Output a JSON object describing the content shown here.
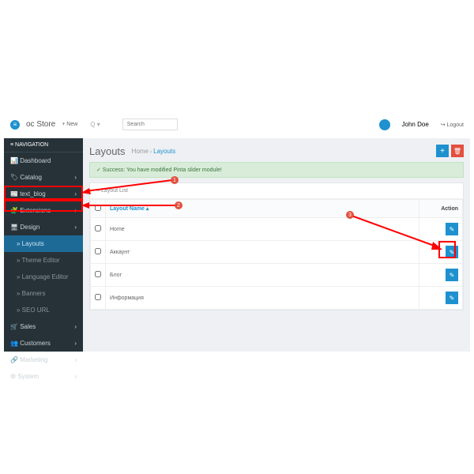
{
  "brand": {
    "name": "oc Store"
  },
  "top": {
    "new": "+ New",
    "search_ph": "Search",
    "user": "John Doe",
    "logout": "↪ Logout"
  },
  "nav": {
    "header": "≡ NAVIGATION",
    "dashboard": "Dashboard",
    "catalog": "Catalog",
    "textblog": "text_blog",
    "extensions": "Extensions",
    "design": "Design",
    "layouts": "Layouts",
    "theme": "Theme Editor",
    "lang": "Language Editor",
    "banners": "Banners",
    "seo": "SEO URL",
    "sales": "Sales",
    "customers": "Customers",
    "marketing": "Marketing",
    "system": "System"
  },
  "page": {
    "title": "Layouts",
    "bc_home": "Home",
    "bc_lay": "Layouts"
  },
  "alert": "✓ Success: You have modified Pinta slider module!",
  "panel": {
    "header": "≡ Layout List"
  },
  "table": {
    "col_name": "Layout Name ▴",
    "col_action": "Action",
    "rows": [
      "Home",
      "Аккаунт",
      "Блог",
      "Информация"
    ]
  },
  "icons": {
    "dash": "📊",
    "cat": "🏷",
    "blog": "📰",
    "ext": "🧩",
    "des": "🖥",
    "sales": "🛒",
    "cust": "👥",
    "mkt": "🔗",
    "sys": "⚙",
    "edit": "✎",
    "plus": "+",
    "del": "🗑",
    "chev": "›"
  }
}
